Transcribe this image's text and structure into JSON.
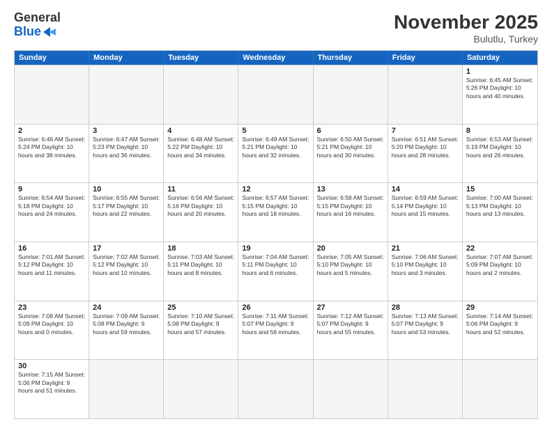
{
  "header": {
    "logo_general": "General",
    "logo_blue": "Blue",
    "title": "November 2025",
    "subtitle": "Bulutlu, Turkey"
  },
  "days_of_week": [
    "Sunday",
    "Monday",
    "Tuesday",
    "Wednesday",
    "Thursday",
    "Friday",
    "Saturday"
  ],
  "weeks": [
    [
      {
        "num": "",
        "info": "",
        "empty": true
      },
      {
        "num": "",
        "info": "",
        "empty": true
      },
      {
        "num": "",
        "info": "",
        "empty": true
      },
      {
        "num": "",
        "info": "",
        "empty": true
      },
      {
        "num": "",
        "info": "",
        "empty": true
      },
      {
        "num": "",
        "info": "",
        "empty": true
      },
      {
        "num": "1",
        "info": "Sunrise: 6:45 AM\nSunset: 5:26 PM\nDaylight: 10 hours\nand 40 minutes."
      }
    ],
    [
      {
        "num": "2",
        "info": "Sunrise: 6:46 AM\nSunset: 5:24 PM\nDaylight: 10 hours\nand 38 minutes."
      },
      {
        "num": "3",
        "info": "Sunrise: 6:47 AM\nSunset: 5:23 PM\nDaylight: 10 hours\nand 36 minutes."
      },
      {
        "num": "4",
        "info": "Sunrise: 6:48 AM\nSunset: 5:22 PM\nDaylight: 10 hours\nand 34 minutes."
      },
      {
        "num": "5",
        "info": "Sunrise: 6:49 AM\nSunset: 5:21 PM\nDaylight: 10 hours\nand 32 minutes."
      },
      {
        "num": "6",
        "info": "Sunrise: 6:50 AM\nSunset: 5:21 PM\nDaylight: 10 hours\nand 30 minutes."
      },
      {
        "num": "7",
        "info": "Sunrise: 6:51 AM\nSunset: 5:20 PM\nDaylight: 10 hours\nand 28 minutes."
      },
      {
        "num": "8",
        "info": "Sunrise: 6:53 AM\nSunset: 5:19 PM\nDaylight: 10 hours\nand 26 minutes."
      }
    ],
    [
      {
        "num": "9",
        "info": "Sunrise: 6:54 AM\nSunset: 5:18 PM\nDaylight: 10 hours\nand 24 minutes."
      },
      {
        "num": "10",
        "info": "Sunrise: 6:55 AM\nSunset: 5:17 PM\nDaylight: 10 hours\nand 22 minutes."
      },
      {
        "num": "11",
        "info": "Sunrise: 6:56 AM\nSunset: 5:16 PM\nDaylight: 10 hours\nand 20 minutes."
      },
      {
        "num": "12",
        "info": "Sunrise: 6:57 AM\nSunset: 5:15 PM\nDaylight: 10 hours\nand 18 minutes."
      },
      {
        "num": "13",
        "info": "Sunrise: 6:58 AM\nSunset: 5:15 PM\nDaylight: 10 hours\nand 16 minutes."
      },
      {
        "num": "14",
        "info": "Sunrise: 6:59 AM\nSunset: 5:14 PM\nDaylight: 10 hours\nand 15 minutes."
      },
      {
        "num": "15",
        "info": "Sunrise: 7:00 AM\nSunset: 5:13 PM\nDaylight: 10 hours\nand 13 minutes."
      }
    ],
    [
      {
        "num": "16",
        "info": "Sunrise: 7:01 AM\nSunset: 5:12 PM\nDaylight: 10 hours\nand 11 minutes."
      },
      {
        "num": "17",
        "info": "Sunrise: 7:02 AM\nSunset: 5:12 PM\nDaylight: 10 hours\nand 10 minutes."
      },
      {
        "num": "18",
        "info": "Sunrise: 7:03 AM\nSunset: 5:11 PM\nDaylight: 10 hours\nand 8 minutes."
      },
      {
        "num": "19",
        "info": "Sunrise: 7:04 AM\nSunset: 5:11 PM\nDaylight: 10 hours\nand 6 minutes."
      },
      {
        "num": "20",
        "info": "Sunrise: 7:05 AM\nSunset: 5:10 PM\nDaylight: 10 hours\nand 5 minutes."
      },
      {
        "num": "21",
        "info": "Sunrise: 7:06 AM\nSunset: 5:10 PM\nDaylight: 10 hours\nand 3 minutes."
      },
      {
        "num": "22",
        "info": "Sunrise: 7:07 AM\nSunset: 5:09 PM\nDaylight: 10 hours\nand 2 minutes."
      }
    ],
    [
      {
        "num": "23",
        "info": "Sunrise: 7:08 AM\nSunset: 5:09 PM\nDaylight: 10 hours\nand 0 minutes."
      },
      {
        "num": "24",
        "info": "Sunrise: 7:09 AM\nSunset: 5:08 PM\nDaylight: 9 hours\nand 59 minutes."
      },
      {
        "num": "25",
        "info": "Sunrise: 7:10 AM\nSunset: 5:08 PM\nDaylight: 9 hours\nand 57 minutes."
      },
      {
        "num": "26",
        "info": "Sunrise: 7:11 AM\nSunset: 5:07 PM\nDaylight: 9 hours\nand 56 minutes."
      },
      {
        "num": "27",
        "info": "Sunrise: 7:12 AM\nSunset: 5:07 PM\nDaylight: 9 hours\nand 55 minutes."
      },
      {
        "num": "28",
        "info": "Sunrise: 7:13 AM\nSunset: 5:07 PM\nDaylight: 9 hours\nand 53 minutes."
      },
      {
        "num": "29",
        "info": "Sunrise: 7:14 AM\nSunset: 5:06 PM\nDaylight: 9 hours\nand 52 minutes."
      }
    ],
    [
      {
        "num": "30",
        "info": "Sunrise: 7:15 AM\nSunset: 5:06 PM\nDaylight: 9 hours\nand 51 minutes."
      },
      {
        "num": "",
        "info": "",
        "empty": true
      },
      {
        "num": "",
        "info": "",
        "empty": true
      },
      {
        "num": "",
        "info": "",
        "empty": true
      },
      {
        "num": "",
        "info": "",
        "empty": true
      },
      {
        "num": "",
        "info": "",
        "empty": true
      },
      {
        "num": "",
        "info": "",
        "empty": true
      }
    ]
  ]
}
